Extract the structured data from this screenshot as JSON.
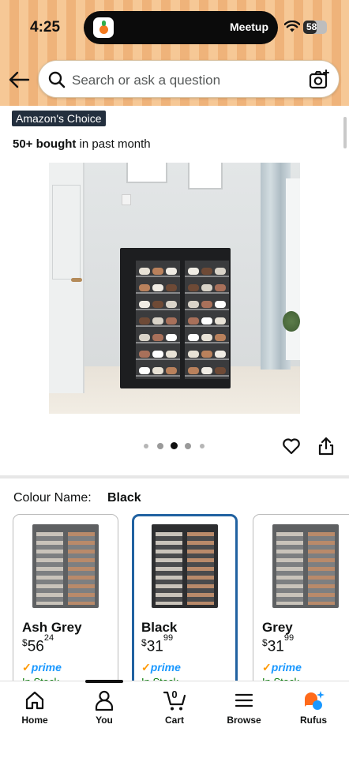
{
  "status_bar": {
    "time": "4:25",
    "live_activity": "Meetup",
    "battery": "58",
    "battery_level": 0.58
  },
  "search": {
    "placeholder": "Search or ask a question"
  },
  "product": {
    "badge": "Amazon's Choice",
    "bought_count": "50+ bought",
    "bought_suffix": " in past month",
    "image_count": 5,
    "active_image": 3
  },
  "colour": {
    "label": "Colour Name:",
    "selected": "Black",
    "options": [
      {
        "name": "Ash Grey",
        "currency": "$",
        "price_whole": "56",
        "price_fraction": "24",
        "prime": "prime",
        "stock": "In Stock"
      },
      {
        "name": "Black",
        "currency": "$",
        "price_whole": "31",
        "price_fraction": "99",
        "prime": "prime",
        "stock": "In Stock"
      },
      {
        "name": "Grey",
        "currency": "$",
        "price_whole": "31",
        "price_fraction": "99",
        "prime": "prime",
        "stock": "In Stock"
      }
    ]
  },
  "bottom_nav": {
    "items": [
      {
        "label": "Home",
        "icon": "home-icon"
      },
      {
        "label": "You",
        "icon": "user-icon"
      },
      {
        "label": "Cart",
        "icon": "cart-icon",
        "count": "0"
      },
      {
        "label": "Browse",
        "icon": "menu-icon"
      },
      {
        "label": "Rufus",
        "icon": "rufus-icon"
      }
    ]
  },
  "colors": {
    "header": "#f6c896",
    "selected_border": "#2162a1",
    "prime": "#1a98ff",
    "prime_check": "#ff9900",
    "badge_bg": "#232f3e"
  }
}
